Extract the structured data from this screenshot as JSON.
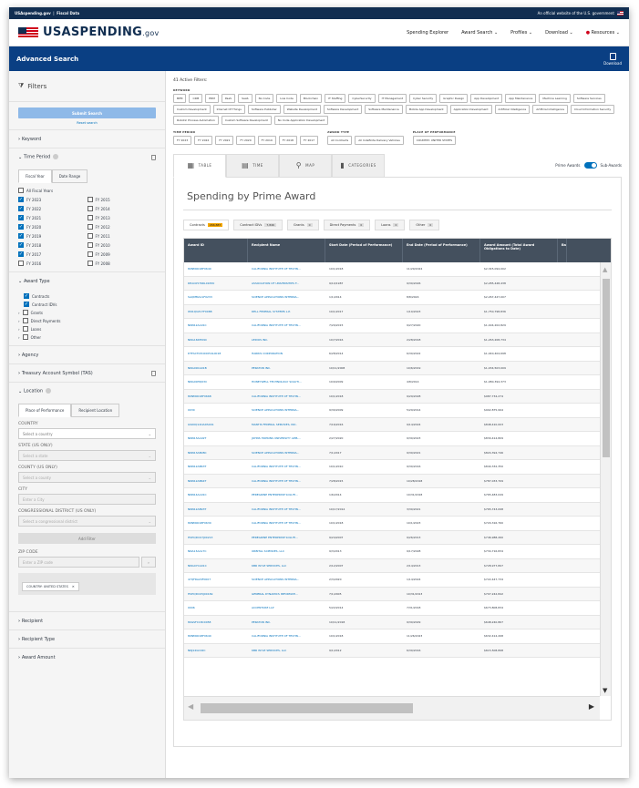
{
  "gov_banner": {
    "left": "USAspending.gov",
    "sep": "|",
    "right_left": "Fiscal Data",
    "official": "An official website of the U.S. government"
  },
  "header": {
    "logo": "USASPENDING",
    "logo_suffix": ".gov",
    "nav": [
      "Spending Explorer",
      "Award Search ⌄",
      "Profiles ⌄",
      "Download ⌄",
      "Resources ⌄"
    ]
  },
  "page": {
    "title": "Advanced Search",
    "download": "Download"
  },
  "sidebar": {
    "filters": "Filters",
    "submit": "Submit Search",
    "reset": "Reset search",
    "keyword": "Keyword",
    "time_period": "Time Period",
    "tabs": [
      "Fiscal Year",
      "Date Range"
    ],
    "all_fy": "All Fiscal Years",
    "fiscal_years": [
      {
        "l": "FY 2023",
        "c": true
      },
      {
        "l": "FY 2015",
        "c": false
      },
      {
        "l": "FY 2022",
        "c": true
      },
      {
        "l": "FY 2014",
        "c": false
      },
      {
        "l": "FY 2021",
        "c": true
      },
      {
        "l": "FY 2013",
        "c": false
      },
      {
        "l": "FY 2020",
        "c": true
      },
      {
        "l": "FY 2012",
        "c": false
      },
      {
        "l": "FY 2019",
        "c": true
      },
      {
        "l": "FY 2011",
        "c": false
      },
      {
        "l": "FY 2018",
        "c": true
      },
      {
        "l": "FY 2010",
        "c": false
      },
      {
        "l": "FY 2017",
        "c": true
      },
      {
        "l": "FY 2009",
        "c": false
      },
      {
        "l": "FY 2016",
        "c": false
      },
      {
        "l": "FY 2008",
        "c": false
      }
    ],
    "award_type": "Award Type",
    "award_types": [
      {
        "l": "Contracts",
        "c": true
      },
      {
        "l": "Contract IDVs",
        "c": true
      },
      {
        "l": "Grants",
        "c": false
      },
      {
        "l": "Direct Payments",
        "c": false
      },
      {
        "l": "Loans",
        "c": false
      },
      {
        "l": "Other",
        "c": false
      }
    ],
    "agency": "Agency",
    "tas": "Treasury Account Symbol (TAS)",
    "location": "Location",
    "loc_tabs": [
      "Place of Performance",
      "Recipient Location"
    ],
    "country_lbl": "COUNTRY",
    "country_ph": "Select a country",
    "state_lbl": "STATE (US ONLY)",
    "state_ph": "Select a state",
    "county_lbl": "COUNTY (US ONLY)",
    "county_ph": "Select a county",
    "city_lbl": "CITY",
    "city_ph": "Enter a City",
    "cd_lbl": "CONGRESSIONAL DISTRICT (US ONLY)",
    "cd_ph": "Select a congressional district",
    "add_filter": "Add Filter",
    "zip_lbl": "ZIP CODE",
    "zip_ph": "Enter a ZIP code",
    "chip": "COUNTRY: UNITED STATES",
    "recipient": "Recipient",
    "recipient_type": "Recipient Type",
    "award_amount": "Award Amount"
  },
  "main": {
    "active": "41 Active Filters:",
    "keyword_lbl": "KEYWORD",
    "keywords": [
      "BPM",
      "CRM",
      "ERM",
      "PaaS",
      "SaaS",
      "No Code",
      "Low Code",
      "Blockchain",
      "IT Staffing",
      "CyberSecurity",
      "IT Management",
      "Cyber Security",
      "Graphic Design",
      "App Development",
      "App Maintenance",
      "Machine Learning",
      "Software Services",
      "Custom Development",
      "Internet Of Things",
      "Software Publisher",
      "Website Development",
      "Software Development",
      "Software Maintenance",
      "Mobile App Development",
      "Application Development",
      "Artificial Intelligence",
      "Artificial intelligence",
      "Cloud Information Security",
      "Robotic Process Automation",
      "Custom Software Development",
      "No Code Application Development"
    ],
    "time_lbl": "TIME PERIOD",
    "times": [
      "FY 2023",
      "FY 2022",
      "FY 2021",
      "FY 2020",
      "FY 2019",
      "FY 2018",
      "FY 2017"
    ],
    "award_lbl": "AWARD TYPE",
    "awards": [
      "All Contracts",
      "All Indefinite Delivery Vehicles"
    ],
    "pop_lbl": "PLACE OF PERFORMANCE",
    "pops": [
      "COUNTRY: UNITED STATES"
    ],
    "views": [
      "TABLE",
      "TIME",
      "MAP",
      "CATEGORIES"
    ],
    "prime": "Prime Awards",
    "sub": "Sub-Awards",
    "card_title": "Spending by Prime Award",
    "tabs": [
      {
        "l": "Contracts",
        "c": "266,887"
      },
      {
        "l": "Contract IDVs",
        "c": "7,846"
      },
      {
        "l": "Grants",
        "c": "0"
      },
      {
        "l": "Direct Payments",
        "c": "0"
      },
      {
        "l": "Loans",
        "c": "0"
      },
      {
        "l": "Other",
        "c": "0"
      }
    ],
    "cols": [
      "Award ID",
      "Recipient Name",
      "Start Date (Period of Performance)",
      "End Date (Period of Performance)",
      "Award Amount (Total Award Obligations to Date)",
      "Ba"
    ],
    "rows": [
      [
        "80NM0018F0640",
        "CALIFORNIA INSTITUTE OF TECHN...",
        "10/1/2018",
        "11/29/2024",
        "$2,345,094,002"
      ],
      [
        "DEAC0576RL01830",
        "ASSOCIATION OF UNIVERSITIES F...",
        "9/10/1987",
        "9/30/2026",
        "$2,285,448,438"
      ],
      [
        "SAQMMA11F0233",
        "SCIENCE APPLICATIONS INTERNA...",
        "1/1/2014",
        "8/8/2024",
        "$2,267,447,007"
      ],
      [
        "W91QUZ17F0088",
        "DELL FEDERAL SYSTEMS L.P.",
        "10/1/2017",
        "1/10/2023",
        "$1,750,798,836"
      ],
      [
        "NNN12AA01C",
        "CALIFORNIA INSTITUTE OF TECHN...",
        "7/29/2015",
        "9/27/2020",
        "$1,404,202,829"
      ],
      [
        "NNG16DH09C",
        "LEIDOS INC.",
        "10/7/2016",
        "2/28/2018",
        "$1,263,208,734"
      ],
      [
        "DTFACT03C00054L0018",
        "HARRIS CORPORATION",
        "6/28/2014",
        "6/30/2022",
        "$1,040,404,698"
      ],
      [
        "NNG09CA01B",
        "PERATON INC.",
        "10/11/2008",
        "10/6/2019",
        "$1,034,503,009"
      ],
      [
        "NNG09HQ03C",
        "HONEYWELL TECHNOLOGY SOLUTI...",
        "10/9/2009",
        "4/8/2014",
        "$1,080,394,373"
      ],
      [
        "80NM0018F0668",
        "CALIFORNIA INSTITUTE OF TECHN...",
        "10/1/2018",
        "9/29/2028",
        "$987,734,274"
      ],
      [
        "0030",
        "SCIENCE APPLICATIONS INTERNA...",
        "9/30/2009",
        "5/29/2014",
        "$902,875,994"
      ],
      [
        "GS00Q14OADS001",
        "MANTIS FEDERAL SERVICES, INC.",
        "7/16/2016",
        "9/14/2024",
        "$848,410,003"
      ],
      [
        "NNN13AA02T",
        "JOHNS HOPKINS UNIVERSITY APPL...",
        "2/27/2020",
        "9/30/2023",
        "$830,414,809"
      ],
      [
        "NNN13AB08C",
        "SCIENCE APPLICATIONS INTERNA...",
        "7/1/2017",
        "9/30/2021",
        "$824,394,746"
      ],
      [
        "NNN12AB63T",
        "CALIFORNIA INSTITUTE OF TECHN...",
        "10/1/2010",
        "9/30/2016",
        "$840,332,350"
      ],
      [
        "NNN12AB64T",
        "CALIFORNIA INSTITUTE OF TECHN...",
        "7/28/2015",
        "10/28/2018",
        "$787,033,709"
      ],
      [
        "NNN14AA01C",
        "PEREGRINE ENTERPRISE SOLUTI...",
        "1/6/2014",
        "10/31/2018",
        "$765,483,049"
      ],
      [
        "NNN12AB93T",
        "CALIFORNIA INSTITUTE OF TECHN...",
        "10/17/2014",
        "3/30/2021",
        "$765,743,098"
      ],
      [
        "80NM0018F0630",
        "CALIFORNIA INSTITUTE OF TECHN...",
        "10/1/2018",
        "10/1/2023",
        "$720,316,760"
      ],
      [
        "HSHQDC07J00213",
        "PEREGRINE ENTERPRISE SOLUTI...",
        "9/24/2007",
        "9/26/2013",
        "$746,988,260"
      ],
      [
        "NNA13AA17C",
        "ORBITAL SCIENCES, LLC",
        "9/3/2013",
        "9/17/2028",
        "$734,716,834"
      ],
      [
        "NNG07CA01C",
        "KBR WYLE SERVICES, LLC",
        "2/12/2007",
        "2/14/2013",
        "$728,977,897"
      ],
      [
        "47QFRA20F0007",
        "SCIENCE APPLICATIONS INTERNA...",
        "2/3/2020",
        "1/14/2024",
        "$722,447,734"
      ],
      [
        "HSHQDC05J00169",
        "GENERAL DYNAMICS INFORMATI...",
        "7/1/2005",
        "10/31/2013",
        "$707,242,842"
      ],
      [
        "0006",
        "ACCENTURE LLP",
        "5/22/2014",
        "7/31/2018",
        "$673,808,834"
      ],
      [
        "80GSFC18C0058",
        "PERATON INC.",
        "10/11/2018",
        "9/30/2029",
        "$648,240,867"
      ],
      [
        "80NM0018F0640",
        "CALIFORNIA INSTITUTE OF TECHN...",
        "10/1/2018",
        "11/26/2023",
        "$632,414,498"
      ],
      [
        "NNJ14GC02C",
        "KBR WYLE SERVICES, LLC",
        "9/1/2012",
        "6/30/2016",
        "$615,508,898"
      ]
    ]
  },
  "colors": {
    "primary": "#0071bc",
    "header": "#0a3f83",
    "table_head": "#44505e",
    "active_count": "#f3a600"
  }
}
